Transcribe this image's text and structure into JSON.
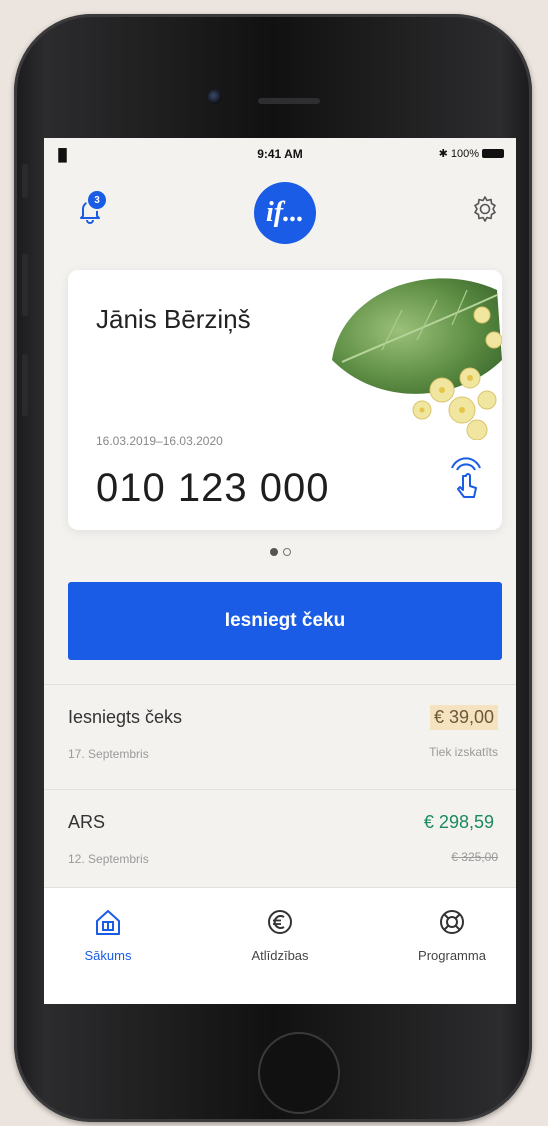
{
  "status_bar": {
    "signal": "▐▌",
    "time": "9:41 AM",
    "battery_text": "✱ 100%"
  },
  "header": {
    "notification_count": "3",
    "logo_text": "if..."
  },
  "card": {
    "holder_name": "Jānis Bērziņš",
    "validity": "16.03.2019–16.03.2020",
    "number": "010 123 000"
  },
  "pager": {
    "total": 2,
    "active_index": 0
  },
  "cta": {
    "label": "Iesniegt čeku"
  },
  "list": {
    "items": [
      {
        "title": "Iesniegts čeks",
        "date": "17. Septembris",
        "amount": "€ 39,00",
        "status": "Tiek izskatīts"
      },
      {
        "title": "ARS",
        "date": "12. Septembris",
        "amount": "€ 298,59",
        "original_amount": "€ 325,00"
      }
    ]
  },
  "tabs": [
    {
      "label": "Sākums",
      "icon": "home-icon",
      "active": true
    },
    {
      "label": "Atlīdzības",
      "icon": "euro-coin-icon",
      "active": false
    },
    {
      "label": "Programma",
      "icon": "lifebuoy-icon",
      "active": false
    }
  ],
  "colors": {
    "brand_blue": "#1a5ce6",
    "pending_bg": "#f5e3bf",
    "discount_green": "#1b8a5e"
  }
}
